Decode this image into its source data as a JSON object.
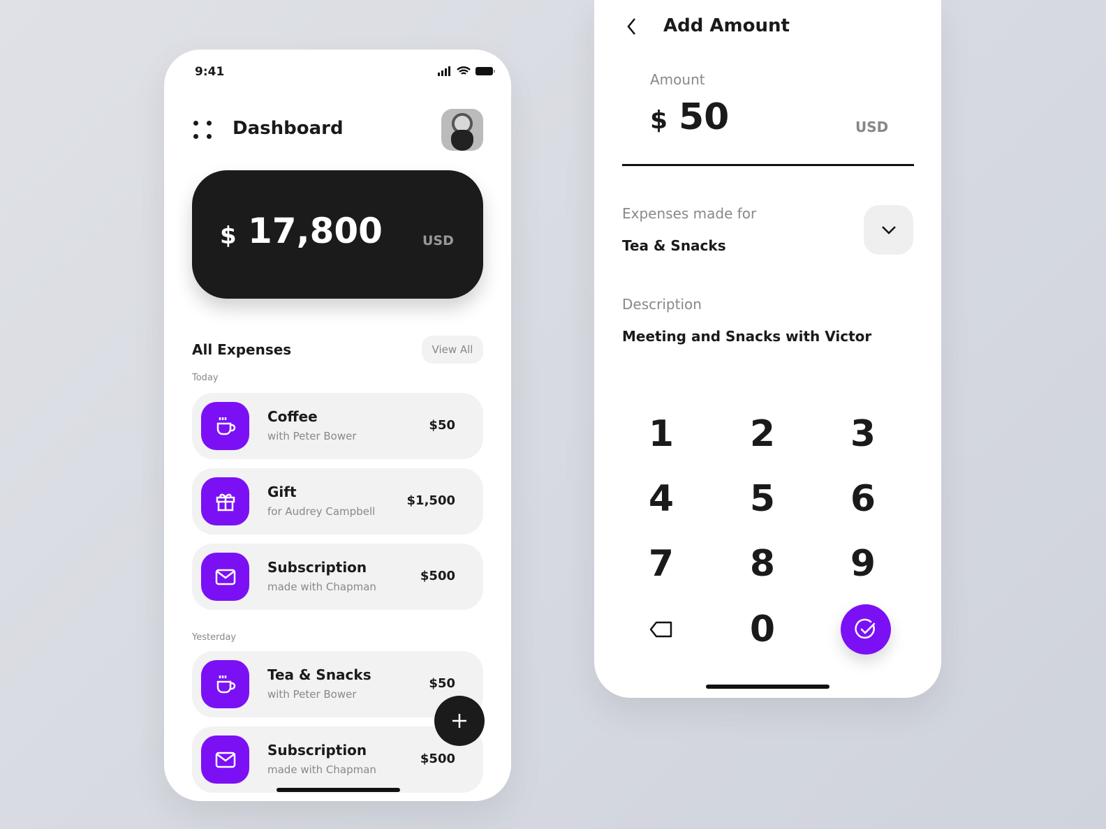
{
  "colors": {
    "accent": "#7b10f5",
    "dark": "#1b1b1b"
  },
  "dashboard": {
    "status_time": "9:41",
    "title": "Dashboard",
    "balance": {
      "currency_symbol": "$",
      "amount": "17,800",
      "currency": "USD"
    },
    "section_title": "All Expenses",
    "view_all": "View All",
    "groups": [
      {
        "label": "Today",
        "items": [
          {
            "icon": "coffee-icon",
            "name": "Coffee",
            "sub": "with Peter Bower",
            "amount": "$50"
          },
          {
            "icon": "gift-icon",
            "name": "Gift",
            "sub": "for Audrey Campbell",
            "amount": "$1,500"
          },
          {
            "icon": "mail-icon",
            "name": "Subscription",
            "sub": "made with Chapman",
            "amount": "$500"
          }
        ]
      },
      {
        "label": "Yesterday",
        "items": [
          {
            "icon": "coffee-icon",
            "name": "Tea & Snacks",
            "sub": "with Peter Bower",
            "amount": "$50"
          },
          {
            "icon": "mail-icon",
            "name": "Subscription",
            "sub": "made with Chapman",
            "amount": "$500"
          }
        ]
      }
    ]
  },
  "add_amount": {
    "title": "Add Amount",
    "amount_label": "Amount",
    "currency_symbol": "$",
    "amount": "50",
    "currency": "USD",
    "expense_label": "Expenses made for",
    "expense_value": "Tea & Snacks",
    "description_label": "Description",
    "description_value": "Meeting and Snacks with Victor",
    "keys": [
      "1",
      "2",
      "3",
      "4",
      "5",
      "6",
      "7",
      "8",
      "9",
      "0"
    ]
  }
}
